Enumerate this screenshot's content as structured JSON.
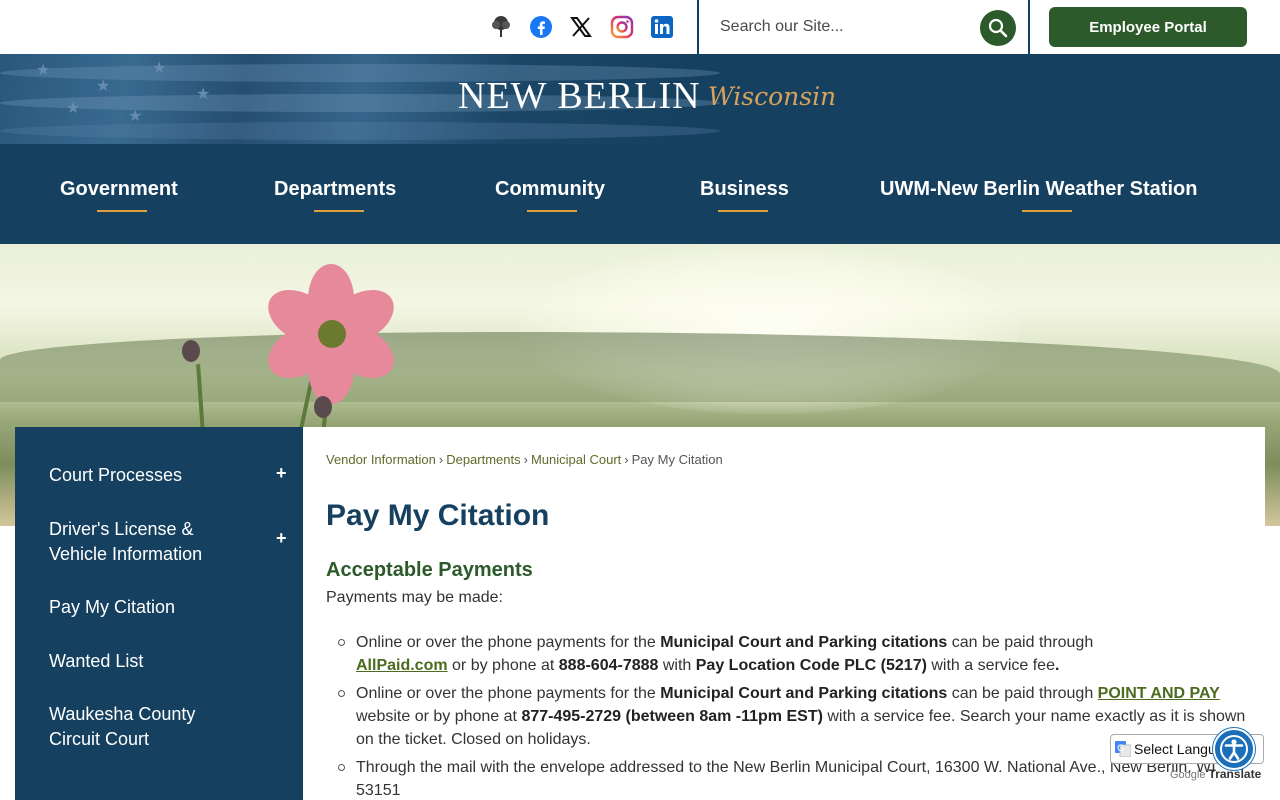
{
  "topbar": {
    "social_icons": [
      "tree-icon",
      "facebook-icon",
      "x-icon",
      "instagram-icon",
      "linkedin-icon"
    ],
    "search_placeholder": "Search our Site...",
    "employee_portal_label": "Employee Portal"
  },
  "header": {
    "logo_main": "NEW BERLIN",
    "logo_sub": "Wisconsin",
    "nav": [
      {
        "label": "Government"
      },
      {
        "label": "Departments"
      },
      {
        "label": "Community"
      },
      {
        "label": "Business"
      },
      {
        "label": "UWM-New Berlin Weather Station"
      }
    ]
  },
  "sidebar": {
    "items": [
      {
        "label": "Court Processes",
        "expandable": true
      },
      {
        "label": "Driver's License & Vehicle Information",
        "expandable": true
      },
      {
        "label": "Pay My Citation",
        "expandable": false
      },
      {
        "label": "Wanted List",
        "expandable": false
      },
      {
        "label": "Waukesha County Circuit Court",
        "expandable": false
      }
    ],
    "expand_symbol": "+"
  },
  "breadcrumb": {
    "items": [
      "Vendor Information",
      "Departments",
      "Municipal Court",
      "Pay My Citation"
    ],
    "separator": "›"
  },
  "content": {
    "title": "Pay My Citation",
    "subhead": "Acceptable Payments",
    "intro": "Payments may be made:",
    "list": [
      {
        "a": "Online or over the phone payments for the ",
        "b": "Municipal Court and Parking citations",
        "c": " can be paid through ",
        "link": "AllPaid.com",
        "d": " or by phone at ",
        "e": "888-604-7888",
        "f": " with ",
        "g": "Pay Location Code PLC (5217)",
        "h": " with a service fee",
        "i": "."
      },
      {
        "a": "Online or over the phone payments for the ",
        "b": "Municipal Court and Parking citations",
        "c": " can be paid through ",
        "link": "POINT AND PAY",
        "d": " website or by phone at ",
        "e": "877-495-2729 (between 8am -11pm EST)",
        "f": " with a service fee. Search your name exactly as it is shown on the ticket. Closed on holidays."
      },
      {
        "a": "Through the mail with the envelope addressed to the New Berlin Municipal Court, 16300 W. National Ave., New Berlin, WI 53151"
      }
    ]
  },
  "widgets": {
    "translate_label": "Select Language",
    "powered_by": "Google",
    "translate_word": "Translate"
  },
  "colors": {
    "navy": "#16405f",
    "green": "#2d5a2b",
    "accent": "#e0a040"
  }
}
